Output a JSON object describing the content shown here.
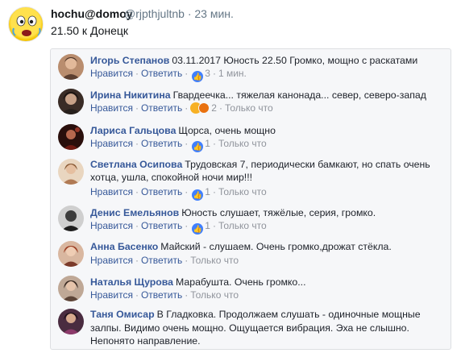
{
  "tweet": {
    "display_name": "hochu@domoy",
    "handle": "@rjpthjultnb",
    "separator": "·",
    "time": "23 мин.",
    "text": "21.50 к Донецк"
  },
  "actions": {
    "like": "Нравится",
    "reply": "Ответить",
    "sep": "·"
  },
  "comments": [
    {
      "author": "Игорь Степанов",
      "text": "03.11.2017 Юность 22.50 Громко, мощно с раскатами",
      "likes": "3",
      "time": "1 мин.",
      "avatar_color": "#6b4e3d"
    },
    {
      "author": "Ирина Никитина",
      "text": "Гвардеечка... тяжелая канонада... север, северо-запад",
      "likes": "2",
      "time": "Только что",
      "avatar_color": "#3b2a24"
    },
    {
      "author": "Лариса Гальцова",
      "text": "Щорса, очень мощно",
      "likes": "1",
      "time": "Только что",
      "avatar_color": "#5a1f1a"
    },
    {
      "author": "Светлана Осипова",
      "text": "Трудовская 7, периодически бамкают, но спать очень хотца, ушла, спокойной ночи мир!!!",
      "likes": "1",
      "time": "Только что",
      "avatar_color": "#c9a27a"
    },
    {
      "author": "Денис Емельянов",
      "text": "Юность слушает, тяжёлые, серия, громко.",
      "likes": "1",
      "time": "Только что",
      "avatar_color": "#2e2e2e"
    },
    {
      "author": "Анна Басенко",
      "text": "Майский - слушаем. Очень громко,дрожат стёкла.",
      "likes": "",
      "time": "Только что",
      "avatar_color": "#a04a2e"
    },
    {
      "author": "Наталья Щурова",
      "text": "Марабушта. Очень громко...",
      "likes": "",
      "time": "Только что",
      "avatar_color": "#8a6a5a"
    },
    {
      "author": "Таня Омисар",
      "text": "В Гладковка. Продолжаем слушать - одиночные мощные залпы. Видимо очень мощно. Ощущается вибрация. Эха не слышно. Непонято направление.",
      "likes": "",
      "time": "",
      "avatar_color": "#6a3a5a"
    }
  ],
  "icons": {
    "like": "like-reaction-icon",
    "haha": "haha-reaction-icon",
    "angry": "angry-reaction-icon"
  }
}
